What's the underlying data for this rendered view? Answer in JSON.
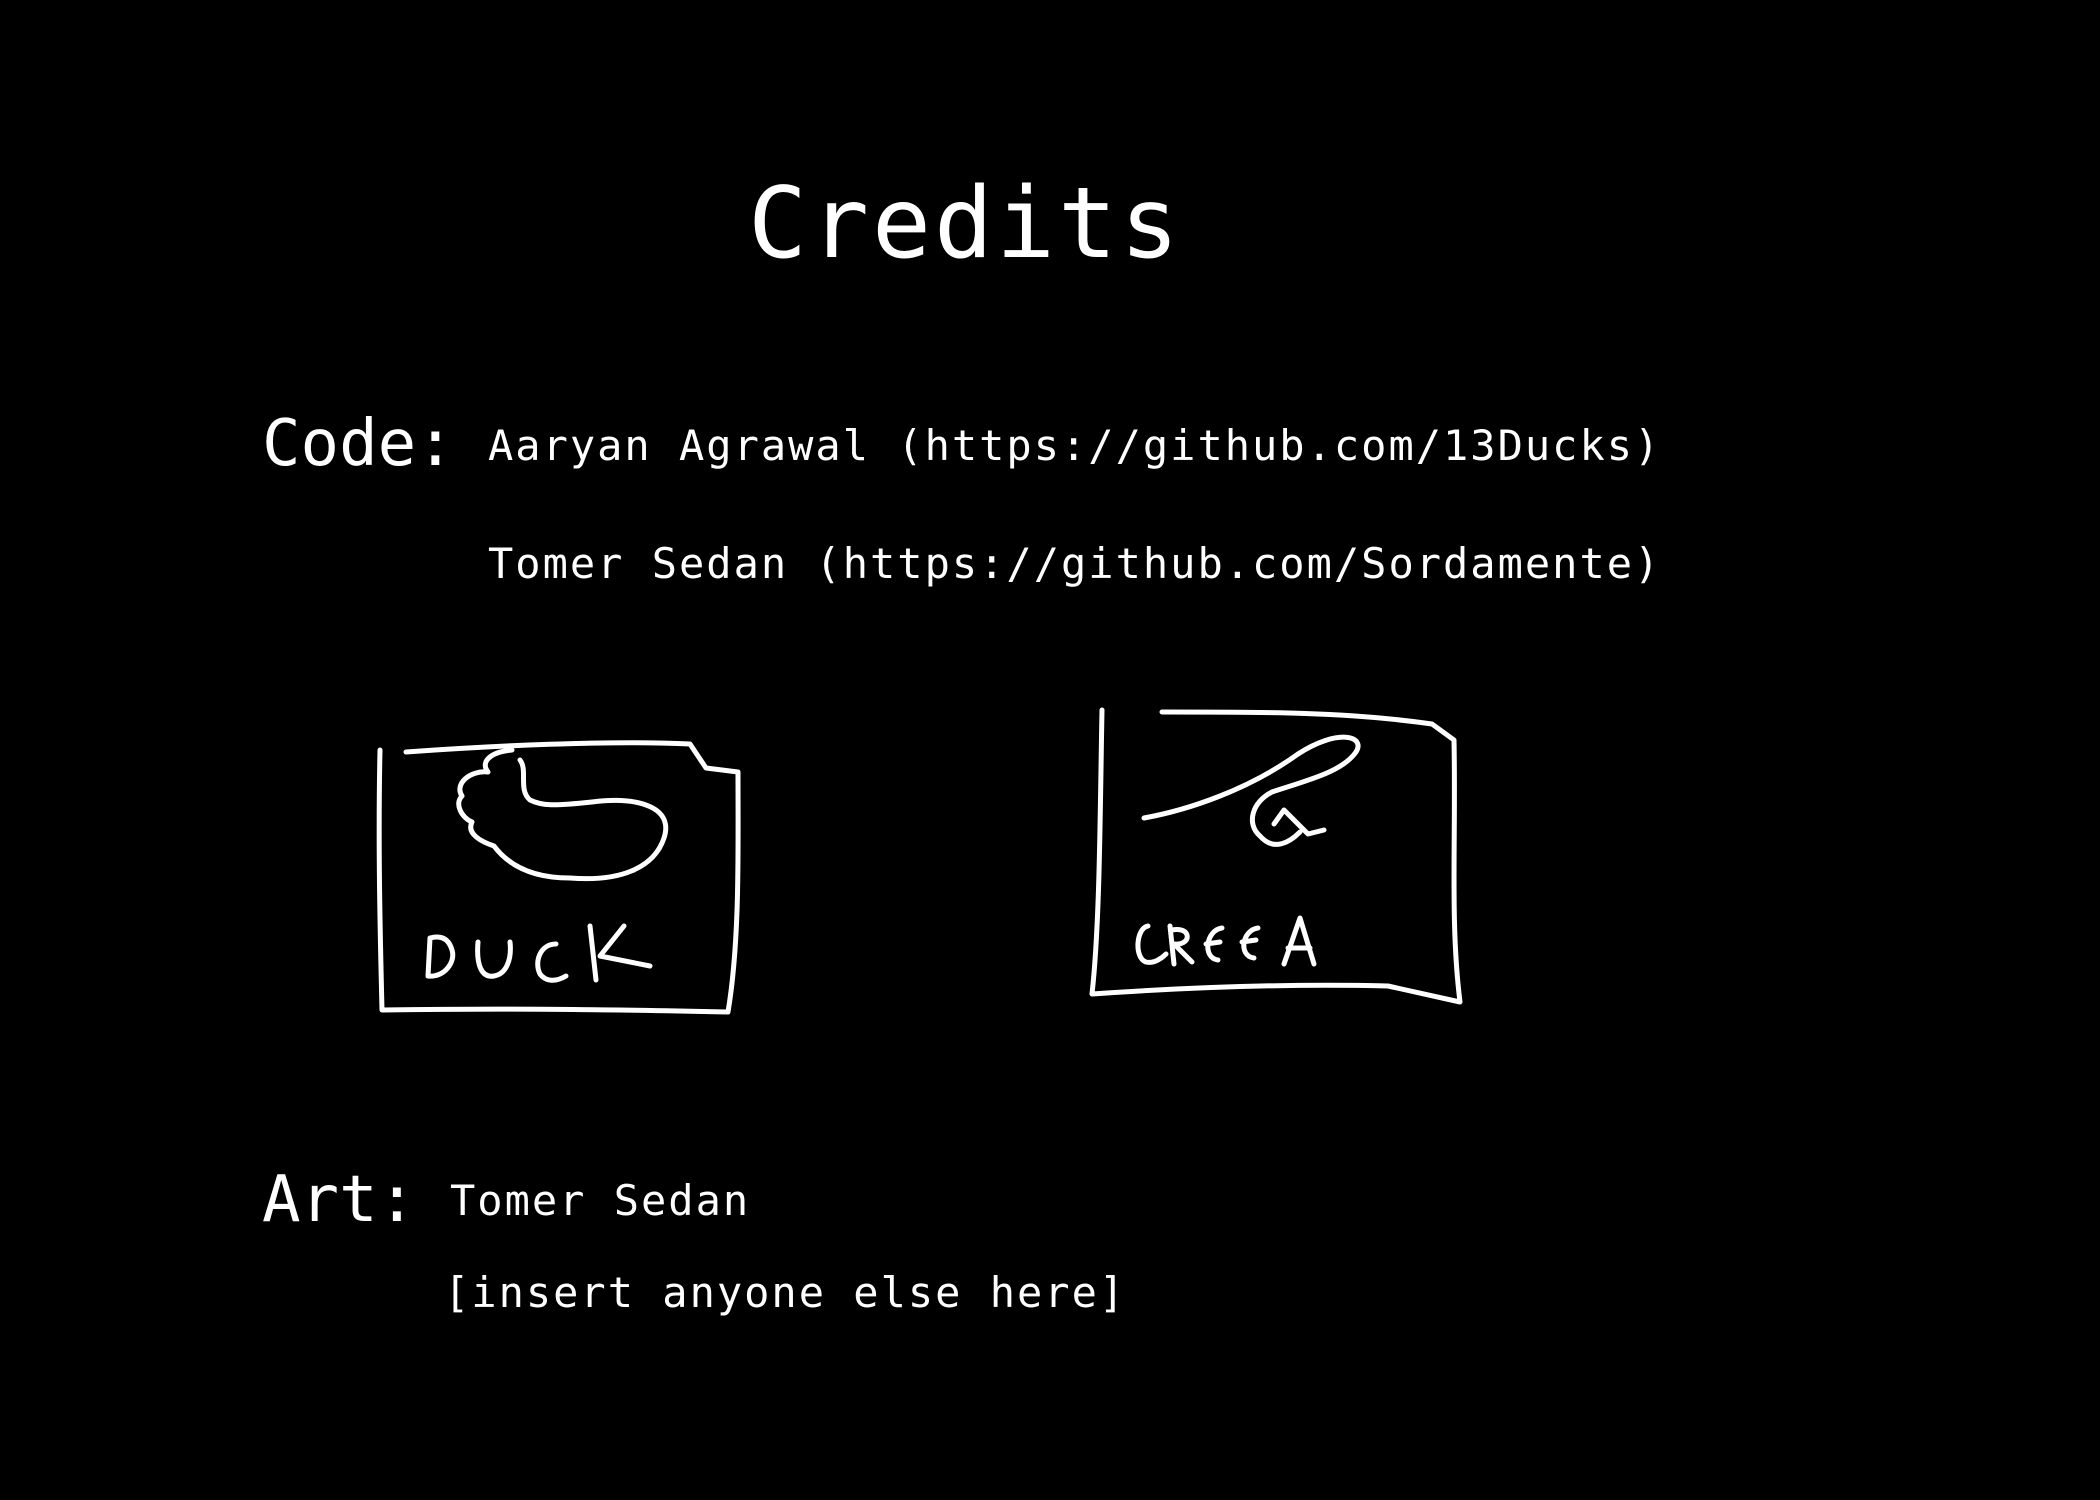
{
  "screen": {
    "background": "#000000",
    "text_color": "#ffffff"
  },
  "title": "Credits",
  "code_section": {
    "label": "Code:",
    "credits": [
      "Aaryan Agrawal (https://github.com/13Ducks)",
      "Tomer Sedan (https://github.com/Sordamente)"
    ]
  },
  "art_section": {
    "label": "Art:",
    "credits": [
      "Tomer Sedan",
      "[insert anyone else here]"
    ]
  },
  "sketches": [
    {
      "subject": "duck",
      "caption": "DUCK"
    },
    {
      "subject": "creature",
      "caption": "CREEA"
    }
  ]
}
